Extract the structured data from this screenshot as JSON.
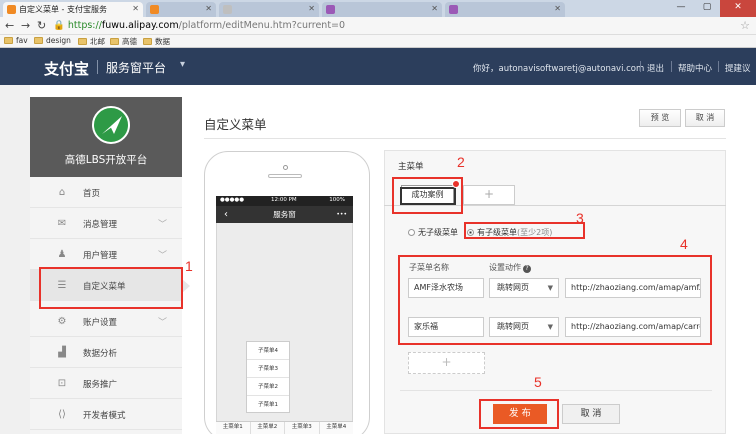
{
  "browser": {
    "active_tab": "自定义菜单 - 支付宝服务",
    "inactive_tabs": [
      "",
      "",
      "",
      ""
    ],
    "url_https": "https://",
    "url_host": "fuwu.alipay.com",
    "url_path": "/platform/editMenu.htm?current=0",
    "bookmarks": [
      "fav",
      "design",
      "北邮",
      "高德",
      "数据"
    ]
  },
  "header": {
    "logo": "支付宝",
    "platform": "服务窗平台",
    "greeting": "你好，autonavisoftwaretj@autonavi.com",
    "links": [
      "退出",
      "帮助中心",
      "提建议"
    ]
  },
  "sidebar": {
    "org_name": "高德LBS开放平台",
    "items": [
      {
        "label": "首页",
        "icon": "home-icon",
        "glyph": "⌂",
        "chevron": false
      },
      {
        "label": "消息管理",
        "icon": "mail-icon",
        "glyph": "✉",
        "chevron": true
      },
      {
        "label": "用户管理",
        "icon": "users-icon",
        "glyph": "♟",
        "chevron": true
      },
      {
        "label": "自定义菜单",
        "icon": "list-icon",
        "glyph": "☰",
        "chevron": false,
        "active": true
      },
      {
        "label": "账户设置",
        "icon": "gear-icon",
        "glyph": "⚙",
        "chevron": true
      },
      {
        "label": "数据分析",
        "icon": "chart-icon",
        "glyph": "▟",
        "chevron": false
      },
      {
        "label": "服务推广",
        "icon": "promo-icon",
        "glyph": "⊡",
        "chevron": false
      },
      {
        "label": "开发者模式",
        "icon": "code-icon",
        "glyph": "⟨⟩",
        "chevron": false
      }
    ]
  },
  "main": {
    "title": "自定义菜单",
    "preview_label": "预 览",
    "cancel_label": "取 消"
  },
  "phone": {
    "status_left": "●●●●● ",
    "status_time": "12:00 PM",
    "status_right": "100%",
    "back": "‹",
    "title": "服务窗",
    "more": "•••",
    "submenu": [
      "子菜单4",
      "子菜单3",
      "子菜单2",
      "子菜单1"
    ],
    "bottom": [
      "主菜单1",
      "主菜单2",
      "主菜单3",
      "主菜单4"
    ]
  },
  "editor": {
    "section_label": "主菜单",
    "tab_label": "成功案例",
    "add_tab": "+",
    "radio_no_sub": "无子级菜单",
    "radio_has_sub": "有子级菜单",
    "radio_hint": "(至少2项)",
    "col_name": "子菜单名称",
    "col_action": "设置动作",
    "rows": [
      {
        "name": "AMF泽水农场",
        "action": "跳转网页",
        "url": "http://zhaoziang.com/amap/amf.htm"
      },
      {
        "name": "家乐福",
        "action": "跳转网页",
        "url": "http://zhaoziang.com/amap/carrefour"
      }
    ],
    "add_row": "+",
    "publish": "发 布",
    "cancel": "取 消"
  },
  "annotations": [
    "1",
    "2",
    "3",
    "4",
    "5"
  ]
}
